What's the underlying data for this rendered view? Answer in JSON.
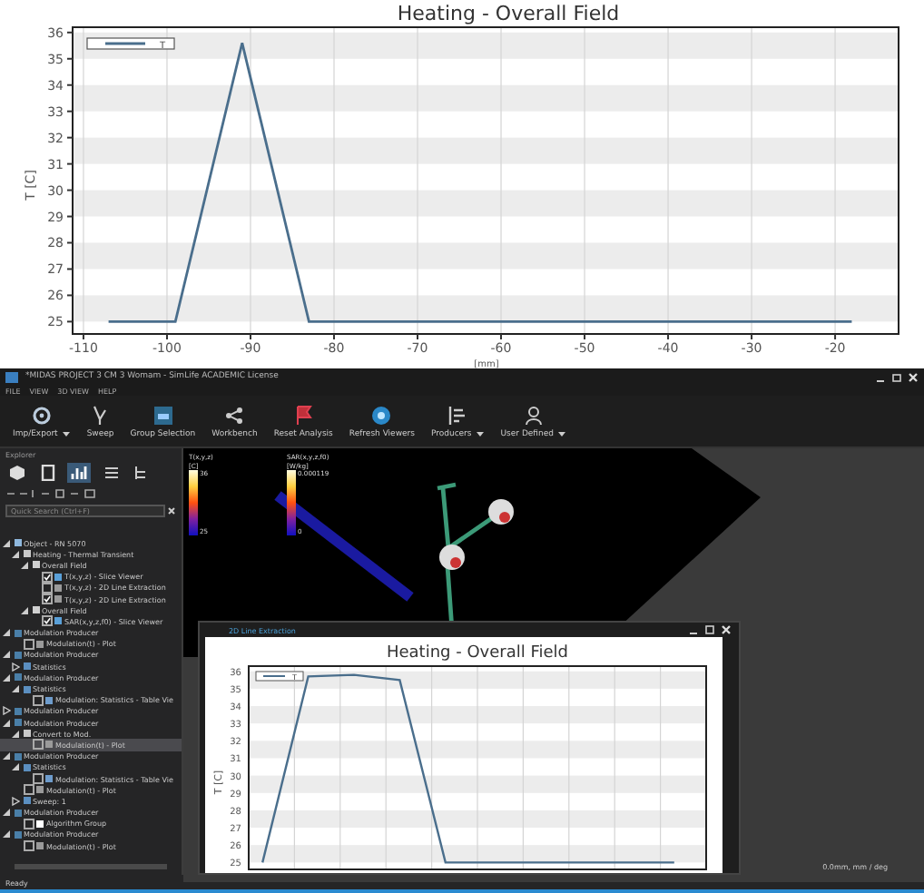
{
  "top_chart": {
    "chart_data": {
      "type": "line",
      "grid": true,
      "title": "Heating - Overall Field",
      "xlabel": "[mm]",
      "ylabel": "T [C]",
      "xlim": [
        -111.3,
        -12.4
      ],
      "ylim": [
        24.53,
        36.2
      ],
      "xticks": [
        -110,
        -100,
        -90,
        -80,
        -70,
        -60,
        -50,
        -40,
        -30,
        -20
      ],
      "yticks": [
        25,
        26,
        27,
        28,
        29,
        30,
        31,
        32,
        33,
        34,
        35,
        36
      ],
      "series": [
        {
          "name": "T",
          "color": "#4a6e8c",
          "x": [
            -107,
            -99,
            -91,
            -83,
            -18
          ],
          "values": [
            25,
            25,
            35.6,
            25,
            25
          ]
        }
      ]
    }
  },
  "window": {
    "title": "*MIDAS PROJECT 3 CM 3 Womam - SimLife ACADEMIC License"
  },
  "menu": [
    "FILE",
    "VIEW",
    "3D VIEW",
    "HELP"
  ],
  "toolbar": [
    {
      "label": "Imp/Export",
      "kind": "gear",
      "dropdown": true
    },
    {
      "label": "Sweep",
      "kind": "sweep",
      "dropdown": false
    },
    {
      "label": "Group Selection",
      "kind": "group",
      "dropdown": false
    },
    {
      "label": "Workbench",
      "kind": "share",
      "dropdown": false
    },
    {
      "label": "Reset Analysis",
      "kind": "flag",
      "dropdown": false
    },
    {
      "label": "Refresh Viewers",
      "kind": "refresh",
      "dropdown": false
    },
    {
      "label": "Producers",
      "kind": "bars",
      "dropdown": true
    },
    {
      "label": "User Defined",
      "kind": "user",
      "dropdown": true
    }
  ],
  "explorer": {
    "title": "Explorer",
    "search": {
      "placeholder": "Quick Search (Ctrl+F)"
    },
    "tabs": [
      {
        "kind": "cube",
        "selected": false
      },
      {
        "kind": "doc",
        "selected": false
      },
      {
        "kind": "chart",
        "selected": true
      }
    ],
    "tree": [
      {
        "label": "Object - RN 5070",
        "kind": "object",
        "expanded": true,
        "selected": false,
        "children": [
          {
            "label": "Heating - Thermal Transient",
            "kind": "analysis",
            "expanded": true,
            "selected": false,
            "children": [
              {
                "label": "Overall Field",
                "kind": "field",
                "expanded": true,
                "selected": false,
                "children": [
                  {
                    "label": "T(x,y,z) - Slice Viewer",
                    "kind": "slice",
                    "checked": true,
                    "selected": false
                  },
                  {
                    "label": "T(x,y,z) - 2D Line Extraction",
                    "kind": "plot",
                    "checked": false,
                    "selected": false
                  },
                  {
                    "label": "T(x,y,z) - 2D Line Extraction",
                    "kind": "plot",
                    "checked": true,
                    "selected": false
                  }
                ]
              },
              {
                "label": "Overall Field",
                "kind": "field",
                "expanded": true,
                "selected": false,
                "children": [
                  {
                    "label": "SAR(x,y,z,f0) - Slice Viewer",
                    "kind": "slice",
                    "checked": true,
                    "selected": false
                  }
                ]
              }
            ]
          }
        ]
      },
      {
        "label": "Modulation Producer",
        "kind": "producer",
        "expanded": true,
        "selected": false,
        "children": [
          {
            "label": "Modulation(t) - Plot",
            "kind": "plot",
            "checked": false,
            "selected": false
          }
        ]
      },
      {
        "label": "Modulation Producer",
        "kind": "producer",
        "expanded": true,
        "selected": false,
        "children": [
          {
            "label": "Statistics",
            "kind": "stats",
            "expanded": false,
            "selected": false
          }
        ]
      },
      {
        "label": "Modulation Producer",
        "kind": "producer",
        "expanded": true,
        "selected": false,
        "children": [
          {
            "label": "Statistics",
            "kind": "stats",
            "expanded": true,
            "selected": false,
            "children": [
              {
                "label": "Modulation: Statistics - Table Vie",
                "kind": "table",
                "checked": false,
                "selected": false
              }
            ]
          }
        ]
      },
      {
        "label": "Modulation Producer",
        "kind": "producer",
        "expanded": false,
        "selected": false
      },
      {
        "label": "Modulation Producer",
        "kind": "producer",
        "expanded": true,
        "selected": false,
        "children": [
          {
            "label": "Convert to Mod.",
            "kind": "analysis",
            "expanded": true,
            "selected": false,
            "children": [
              {
                "label": "Modulation(t) - Plot",
                "kind": "plot",
                "checked": false,
                "selected": true
              }
            ]
          }
        ]
      },
      {
        "label": "Modulation Producer",
        "kind": "producer",
        "expanded": true,
        "selected": false,
        "children": [
          {
            "label": "Statistics",
            "kind": "stats",
            "expanded": true,
            "selected": false,
            "children": [
              {
                "label": "Modulation: Statistics - Table Vie",
                "kind": "table",
                "checked": false,
                "selected": false
              }
            ]
          },
          {
            "label": "Modulation(t) - Plot",
            "kind": "plot",
            "checked": false,
            "selected": false
          },
          {
            "label": "Sweep: 1",
            "kind": "stats",
            "expanded": false,
            "selected": false
          }
        ]
      },
      {
        "label": "Modulation Producer",
        "kind": "producer",
        "expanded": true,
        "selected": false,
        "children": [
          {
            "label": "Algorithm Group",
            "kind": "algorithm",
            "checked": false,
            "selected": false
          }
        ]
      },
      {
        "label": "Modulation Producer",
        "kind": "producer",
        "expanded": true,
        "selected": false,
        "children": [
          {
            "label": "Modulation(t) - Plot",
            "kind": "plot",
            "checked": false,
            "selected": false
          }
        ]
      }
    ]
  },
  "viewer": {
    "colorbars": [
      {
        "name": "T(x,y,z)",
        "unit": "[C]",
        "max": "36",
        "min": "25"
      },
      {
        "name": "SAR(x,y,z,f0)",
        "unit": "[W/kg]",
        "max": "0.000119",
        "min": "0"
      }
    ]
  },
  "plot_window": {
    "title": "2D Line Extraction",
    "chart_data": {
      "type": "line",
      "grid": true,
      "title": "Heating - Overall Field",
      "ylabel": "T [C]",
      "categories": [
        null,
        null,
        null,
        null,
        null,
        null,
        null,
        null,
        null,
        null
      ],
      "ylim": [
        24.6,
        36.3
      ],
      "yticks": [
        25,
        26,
        27,
        28,
        29,
        30,
        31,
        32,
        33,
        34,
        35,
        36
      ],
      "series": [
        {
          "name": "T",
          "color": "#4a6e8c",
          "values": [
            25,
            35.7,
            35.8,
            35.5,
            25,
            25,
            25,
            25,
            25,
            25
          ]
        }
      ]
    }
  },
  "status_bar": {
    "left": "Ready",
    "right": "0.0mm, mm / deg"
  }
}
